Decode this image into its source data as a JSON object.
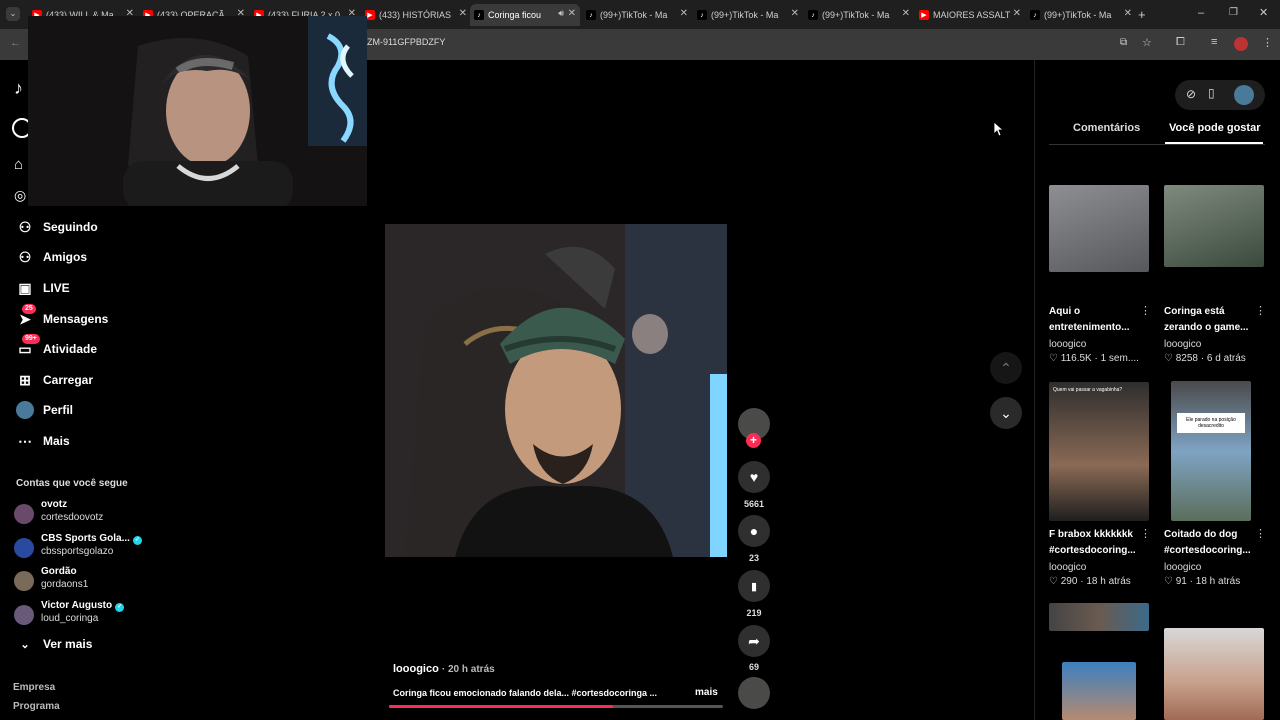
{
  "browser": {
    "tabs": [
      {
        "title": "(433) WILL & Ma",
        "kind": "youtube"
      },
      {
        "title": "(433) OPERAÇÃ",
        "kind": "youtube"
      },
      {
        "title": "(433) FURIA 2 x 0",
        "kind": "youtube"
      },
      {
        "title": "(433) HISTÓRIAS",
        "kind": "youtube"
      },
      {
        "title": "Coringa ficou",
        "kind": "tiktok",
        "active": true
      },
      {
        "title": "(99+)TikTok - Ma",
        "kind": "tiktok"
      },
      {
        "title": "(99+)TikTok - Ma",
        "kind": "tiktok"
      },
      {
        "title": "(99+)TikTok - Ma",
        "kind": "tiktok"
      },
      {
        "title": "MAIORES ASSALT",
        "kind": "youtube"
      },
      {
        "title": "(99+)TikTok - Ma",
        "kind": "tiktok"
      }
    ],
    "url": "ZM-911GFPBDZFY"
  },
  "sidebar": {
    "nav": [
      {
        "label": "Seguindo",
        "icon": "following-icon"
      },
      {
        "label": "Amigos",
        "icon": "friends-icon"
      },
      {
        "label": "LIVE",
        "icon": "live-icon"
      },
      {
        "label": "Mensagens",
        "icon": "messages-icon",
        "badge": "25"
      },
      {
        "label": "Atividade",
        "icon": "activity-icon",
        "badge": "99+"
      },
      {
        "label": "Carregar",
        "icon": "upload-icon"
      },
      {
        "label": "Perfil",
        "icon": "profile-avatar"
      },
      {
        "label": "Mais",
        "icon": "more-icon"
      }
    ],
    "following_heading": "Contas que você segue",
    "accounts": [
      {
        "name": "ovotz",
        "handle": "cortesdoovotz",
        "verified": false
      },
      {
        "name": "CBS Sports Gola...",
        "handle": "cbssportsgolazo",
        "verified": true
      },
      {
        "name": "Gordão",
        "handle": "gordaons1",
        "verified": false
      },
      {
        "name": "Victor Augusto",
        "handle": "loud_coringa",
        "verified": true
      }
    ],
    "see_more": "Ver mais",
    "footer": [
      "Empresa",
      "Programa"
    ]
  },
  "video": {
    "author": "looogico",
    "time": "· 20 h atrás",
    "caption": "Coringa ficou emocionado falando dela... #cortesdocoringa ...",
    "more": "mais",
    "progress": 0.67,
    "likes": "5661",
    "comments": "23",
    "saves": "219",
    "shares": "69"
  },
  "rightpanel": {
    "tabs": [
      "Comentários",
      "Você pode gostar"
    ],
    "active_tab": 1,
    "cards": [
      {
        "title": "Aqui o entretenimento...",
        "author": "looogico",
        "likes": "116.5K",
        "age": "1 sem...."
      },
      {
        "title": "Coringa está zerando o game...",
        "author": "looogico",
        "likes": "8258",
        "age": "6 d atrás"
      },
      {
        "title": "F brabox kkkkkkk #cortesdocoring...",
        "author": "looogico",
        "likes": "290",
        "age": "18 h atrás",
        "overlay": "Quem vai passar a vagabinha?"
      },
      {
        "title": "Coitado do dog #cortesdocoring...",
        "author": "looogico",
        "likes": "91",
        "age": "18 h atrás",
        "overlay": "Ele parado na posição desacredito"
      }
    ]
  },
  "colors": {
    "accent": "#fe2c55",
    "background": "#000000",
    "chrome": "#3a3a3a"
  }
}
